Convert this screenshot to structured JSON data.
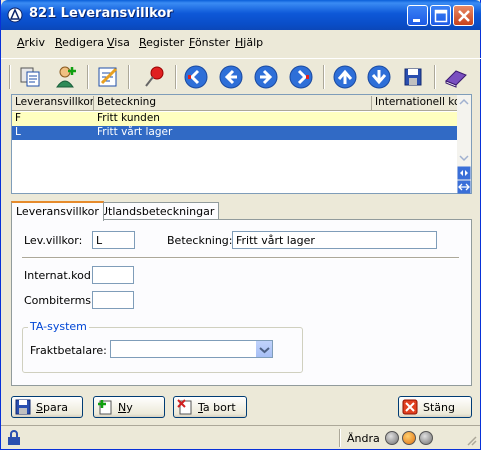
{
  "window": {
    "title": "821 Leveransvillkor"
  },
  "menu": {
    "items": [
      {
        "u": "A",
        "rest": "rkiv"
      },
      {
        "u": "R",
        "rest": "edigera"
      },
      {
        "u": "V",
        "rest": "isa"
      },
      {
        "u": "R",
        "rest": "egister"
      },
      {
        "u": "F",
        "rest": "önster"
      },
      {
        "u": "H",
        "rest": "jälp"
      }
    ]
  },
  "toolbar": {
    "icons": [
      "copy-records-icon",
      "add-user-icon",
      "edit-notes-icon",
      "pin-icon",
      "first-record-icon",
      "previous-record-icon",
      "next-record-icon",
      "last-record-icon",
      "up-icon",
      "down-icon",
      "save-disk-icon",
      "book-icon"
    ]
  },
  "grid": {
    "columns": [
      "Leveransvillkor",
      "Beteckning",
      "Internationell kod"
    ],
    "rows": [
      {
        "code": "F",
        "name": "Fritt kunden",
        "intl": ""
      },
      {
        "code": "L",
        "name": "Fritt vårt lager",
        "intl": ""
      }
    ],
    "selected_row": 1
  },
  "tabs": [
    {
      "label": "Leveransvillkor",
      "active": true
    },
    {
      "label": "Utlandsbeteckningar",
      "active": false
    }
  ],
  "form": {
    "levvillkor_label": "Lev.villkor:",
    "levvillkor_value": "L",
    "beteckning_label": "Beteckning:",
    "beteckning_value": "Fritt vårt lager",
    "internat_label": "Internat.kod:",
    "internat_value": "",
    "combiterms_label": "Combiterms:",
    "combiterms_value": "",
    "ta_system_title": "TA-system",
    "fraktbetalare_label": "Fraktbetalare:",
    "fraktbetalare_value": ""
  },
  "buttons": {
    "spara": {
      "u": "S",
      "rest": "para"
    },
    "ny": {
      "u": "N",
      "rest": "y"
    },
    "tabort": {
      "u": "T",
      "rest": "a bort"
    },
    "stang": {
      "u": "",
      "rest": "Stäng"
    }
  },
  "status": {
    "mode": "Ändra"
  },
  "colors": {
    "title_bar": "#0a4ec8",
    "selection": "#316ac5",
    "highlight_row": "#ffffc0",
    "tab_accent": "#e68b2c",
    "group_title": "#0046d5"
  }
}
